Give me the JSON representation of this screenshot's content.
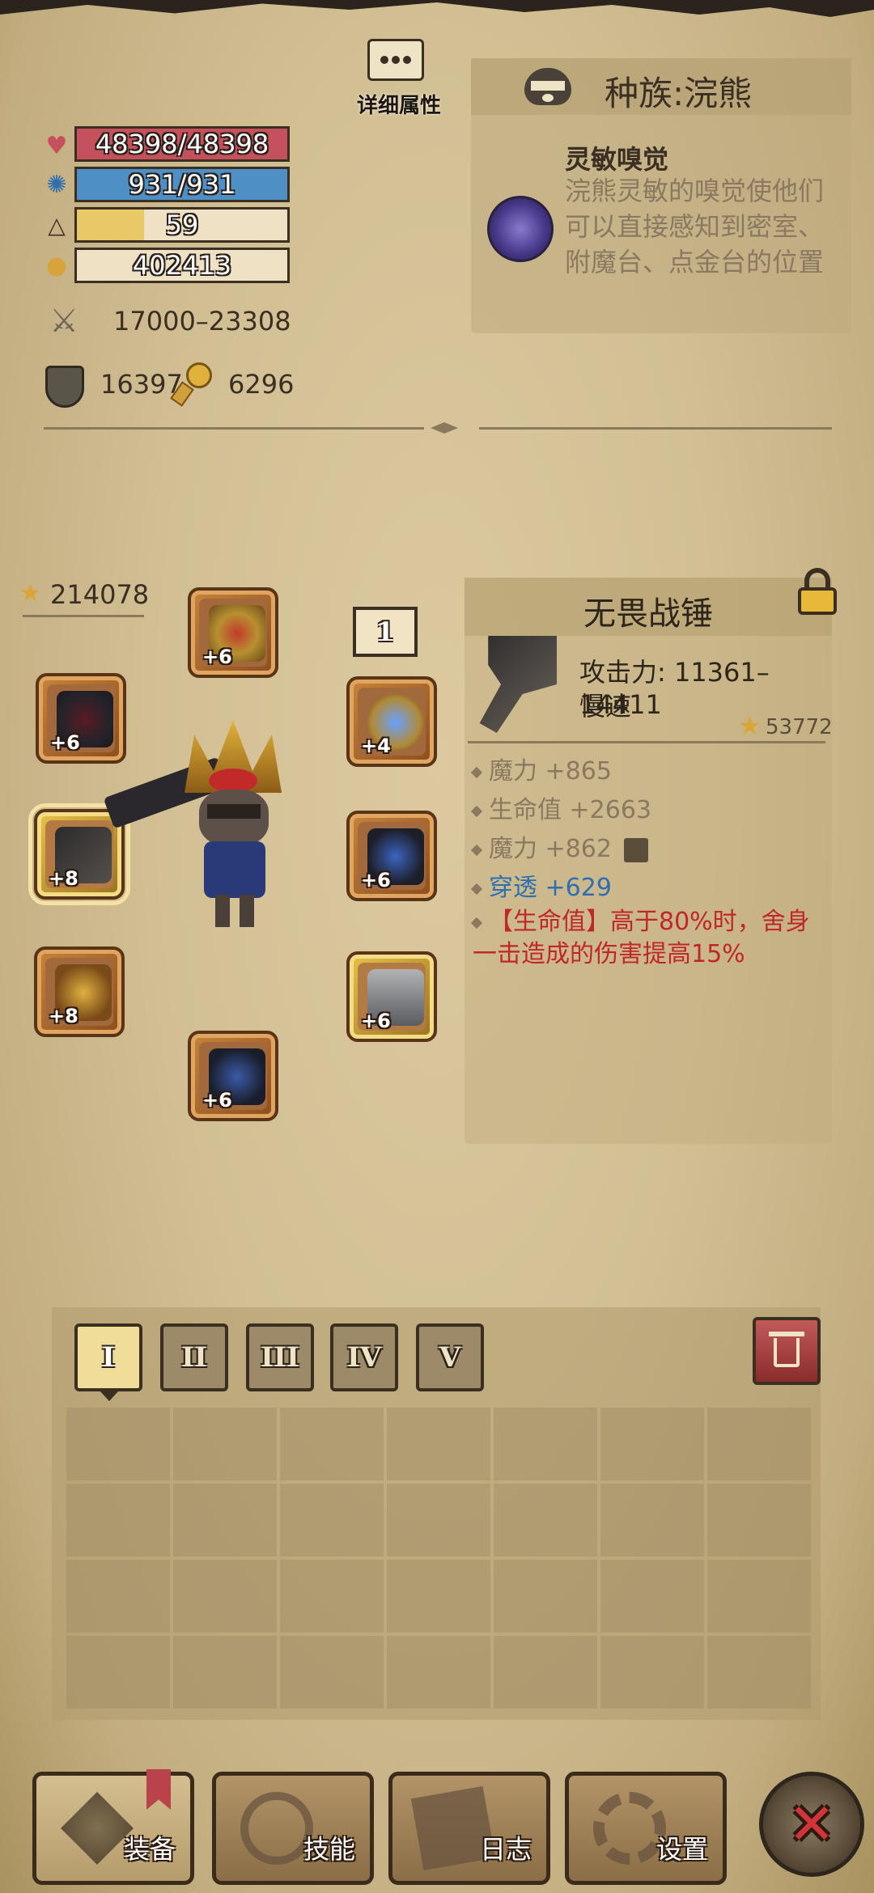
{
  "stats": {
    "hp": "48398/48398",
    "mp": "931/931",
    "level": "59",
    "gold": "402413",
    "attack": "17000–23308",
    "defense": "16397",
    "magic_resist": "6296"
  },
  "detail_button": {
    "label": "详细属性"
  },
  "race": {
    "title": "种族:浣熊",
    "skill_name": "灵敏嗅觉",
    "skill_desc": "浣熊灵敏的嗅觉使他们可以直接感知到密室、附魔台、点金台的位置"
  },
  "equipment": {
    "power": "214078",
    "set_number": "1",
    "slots": [
      {
        "name": "head",
        "plus": "+6"
      },
      {
        "name": "shoulder",
        "plus": "+6"
      },
      {
        "name": "weapon",
        "plus": "+8"
      },
      {
        "name": "gloves",
        "plus": "+8"
      },
      {
        "name": "boots",
        "plus": "+6"
      },
      {
        "name": "accessory",
        "plus": "+4"
      },
      {
        "name": "armor",
        "plus": "+6"
      },
      {
        "name": "legs",
        "plus": "+6"
      }
    ]
  },
  "item": {
    "name": "无畏战锤",
    "attack": "攻击力: 11361–14411",
    "speed": "慢速",
    "score": "53772",
    "attr1": "魔力 +865",
    "attr2": "生命值 +2663",
    "attr3": "魔力 +862",
    "attr4": "穿透 +629",
    "special": "【生命值】高于80%时，舍身一击造成的伤害提高15%"
  },
  "tabs": [
    "I",
    "II",
    "III",
    "IV",
    "V"
  ],
  "nav": {
    "equip": "装备",
    "skills": "技能",
    "log": "日志",
    "settings": "设置"
  },
  "colors": {
    "hp": "#c5515c",
    "mp": "#4e8fc5",
    "xp": "#e8c867",
    "attr_blue": "#2f6fb0",
    "special_red": "#c0262a"
  }
}
